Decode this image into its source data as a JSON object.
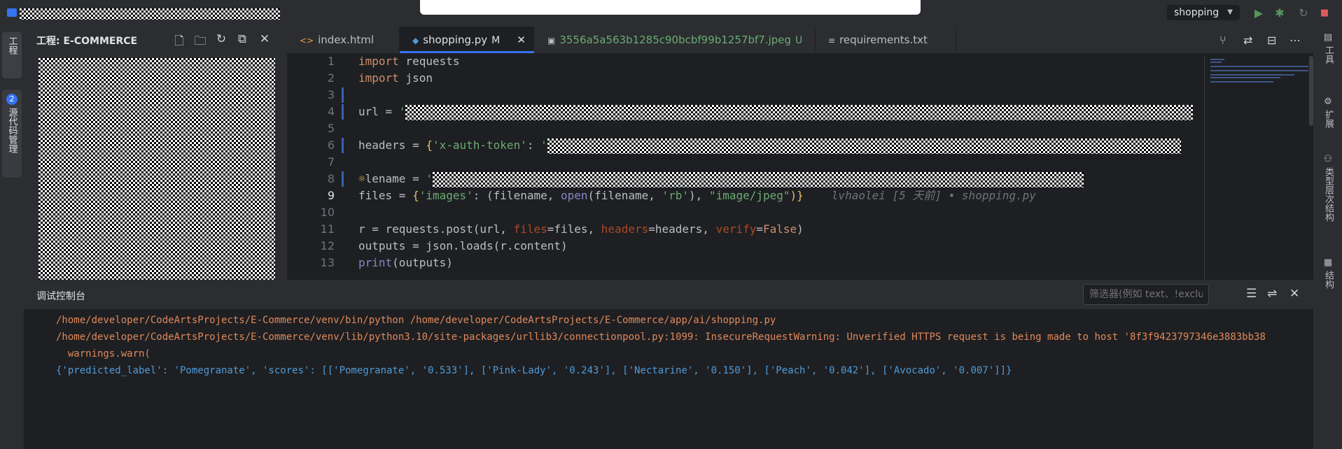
{
  "window": {
    "run_config": "shopping"
  },
  "left_strip": {
    "project_tab": "工程",
    "vcs_tab": "源代码管理",
    "vcs_count": "2"
  },
  "project": {
    "title": "工程: E-COMMERCE"
  },
  "tabs": [
    {
      "label": "index.html",
      "icon": "html-icon",
      "flag": ""
    },
    {
      "label": "shopping.py",
      "icon": "python-icon",
      "flag": "M"
    },
    {
      "label": "3556a5a563b1285c90bcbf99b1257bf7.jpeg",
      "icon": "image-icon",
      "flag": "U"
    },
    {
      "label": "requirements.txt",
      "icon": "text-file-icon",
      "flag": ""
    }
  ],
  "editor": {
    "line_numbers": [
      "1",
      "2",
      "3",
      "4",
      "5",
      "6",
      "7",
      "8",
      "9",
      "10",
      "11",
      "12",
      "13"
    ],
    "l1": {
      "kw": "import",
      "rest": " requests"
    },
    "l2": {
      "kw": "import",
      "rest": " json"
    },
    "l4": {
      "a": "url = ",
      "q": "'"
    },
    "l6": {
      "a": "headers = ",
      "b": "{",
      "k": "'x-auth-token'",
      "c": ": ",
      "q": "'"
    },
    "l8": {
      "a": "lename = ",
      "q": "'"
    },
    "l9": {
      "a": "files = ",
      "b": "{",
      "k": "'images'",
      "c": ": (filename, ",
      "fn": "open",
      "d": "(filename, ",
      "rb": "'rb'",
      "e": "), ",
      "mime": "\"image/jpeg\"",
      "f": ")}",
      "blame": "lvhaolei [5 天前] • shopping.py"
    },
    "l11": {
      "a": "r = requests.post(url, ",
      "p1": "files",
      "b": "=files, ",
      "p2": "headers",
      "c": "=headers, ",
      "p3": "verify",
      "d": "=",
      "kwfalse": "False",
      "e": ")"
    },
    "l12": {
      "a": "outputs = json.loads(r.content)"
    },
    "l13": {
      "fn": "print",
      "a": "(outputs)"
    }
  },
  "console": {
    "title": "调试控制台",
    "filter_placeholder": "筛选器(例如 text、!exclude)",
    "lines": [
      "/home/developer/CodeArtsProjects/E-Commerce/venv/bin/python /home/developer/CodeArtsProjects/E-Commerce/app/ai/shopping.py",
      "/home/developer/CodeArtsProjects/E-Commerce/venv/lib/python3.10/site-packages/urllib3/connectionpool.py:1099: InsecureRequestWarning: Unverified HTTPS request is being made to host '8f3f9423797346e3883bb38",
      "  warnings.warn(",
      "{'predicted_label': 'Pomegranate', 'scores': [['Pomegranate', '0.533'], ['Pink-Lady', '0.243'], ['Nectarine', '0.150'], ['Peach', '0.042'], ['Avocado', '0.007']]}"
    ]
  },
  "right_strip": {
    "tools": "工具",
    "extensions": "扩展",
    "type_hierarchy": "类型层次结构",
    "structure": "结构"
  },
  "colors": {
    "accent": "#3574f0",
    "run": "#57965c",
    "debug": "#57965c",
    "stop": "#db5c5c",
    "error_text": "#e0895b",
    "output_text": "#4f9bd9"
  }
}
